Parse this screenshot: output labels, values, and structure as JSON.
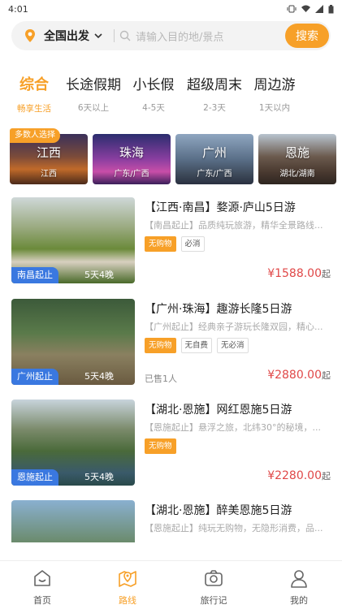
{
  "status_bar": {
    "time": "4:01"
  },
  "search": {
    "location": "全国出发",
    "placeholder": "请输入目的地/景点",
    "button": "搜索"
  },
  "tabs": [
    {
      "title": "综合",
      "sub": "畅享生活",
      "active": true
    },
    {
      "title": "长途假期",
      "sub": "6天以上"
    },
    {
      "title": "小长假",
      "sub": "4-5天"
    },
    {
      "title": "超级周末",
      "sub": "2-3天"
    },
    {
      "title": "周边游",
      "sub": "1天以内"
    }
  ],
  "hot_label": "多数人选择",
  "cities": [
    {
      "name": "江西",
      "region": "江西"
    },
    {
      "name": "珠海",
      "region": "广东/广西"
    },
    {
      "name": "广州",
      "region": "广东/广西"
    },
    {
      "name": "恩施",
      "region": "湖北/湖南"
    }
  ],
  "products": [
    {
      "title": "【江西·南昌】婺源·庐山5日游",
      "desc": "【南昌起止】品质纯玩旅游，精华全景路线...",
      "tags": [
        "无购物",
        "必消"
      ],
      "start": "南昌起止",
      "days": "5天4晚",
      "sold": "",
      "price": "¥1588.00",
      "suffix": "起"
    },
    {
      "title": "【广州·珠海】趣游长隆5日游",
      "desc": "【广州起止】经典亲子游玩长隆双园，精心...",
      "tags": [
        "无购物",
        "无自费",
        "无必消"
      ],
      "start": "广州起止",
      "days": "5天4晚",
      "sold": "已售1人",
      "price": "¥2880.00",
      "suffix": "起"
    },
    {
      "title": "【湖北·恩施】网红恩施5日游",
      "desc": "【恩施起止】悬浮之旅，北纬30°的秘境，...",
      "tags": [
        "无购物"
      ],
      "start": "恩施起止",
      "days": "5天4晚",
      "sold": "",
      "price": "¥2280.00",
      "suffix": "起"
    },
    {
      "title": "【湖北·恩施】醉美恩施5日游",
      "desc": "【恩施起止】纯玩无购物，无隐形消费，品...",
      "tags": [],
      "start": "",
      "days": "",
      "sold": "",
      "price": "",
      "suffix": ""
    }
  ],
  "tabbar": [
    {
      "label": "首页",
      "icon": "home-icon"
    },
    {
      "label": "路线",
      "icon": "map-route-icon",
      "active": true
    },
    {
      "label": "旅行记",
      "icon": "camera-icon"
    },
    {
      "label": "我的",
      "icon": "user-icon"
    }
  ],
  "colors": {
    "accent": "#f7a028",
    "price": "#e04848",
    "badge": "#3a78e0"
  }
}
